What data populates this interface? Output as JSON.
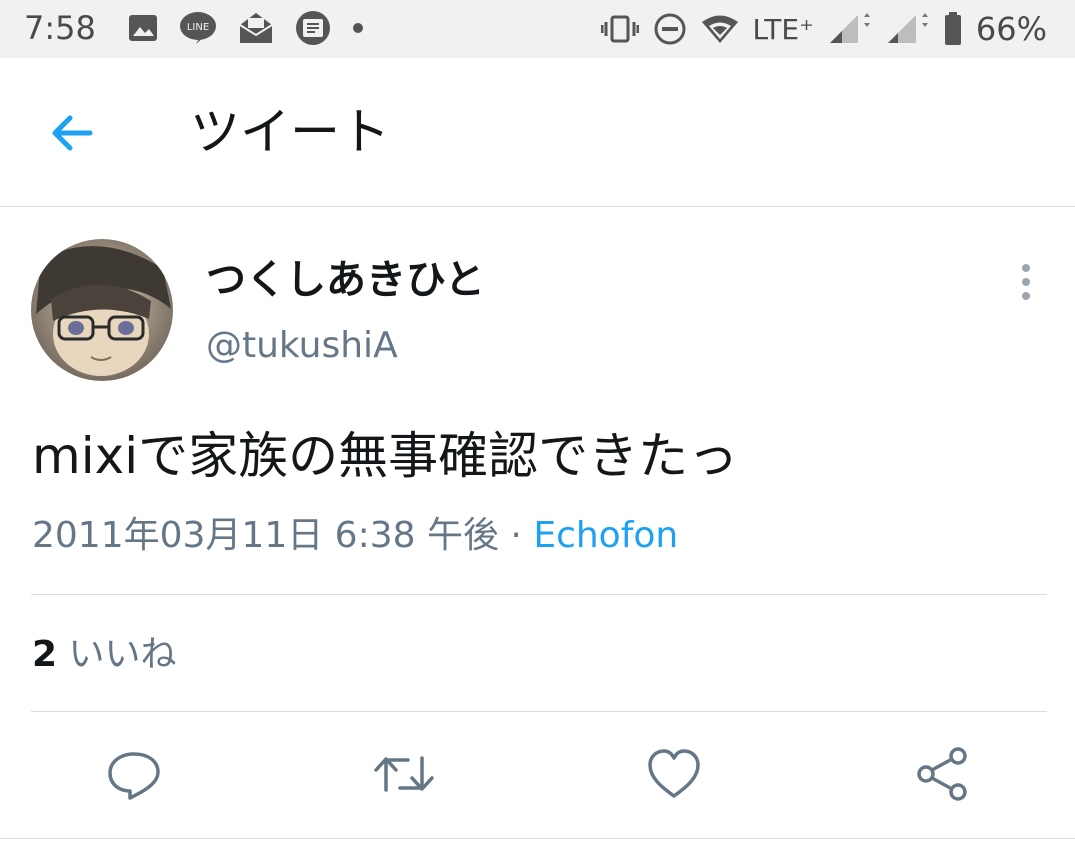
{
  "status_bar": {
    "time": "7:58",
    "left_icons": [
      "image-icon",
      "line-app-icon",
      "yahoo-mail-icon",
      "smartnews-icon",
      "dot-icon"
    ],
    "right_icons": [
      "vibrate-icon",
      "do-not-disturb-icon",
      "wifi-icon",
      "signal-icon",
      "signal-icon",
      "battery-icon"
    ],
    "network": "LTE⁺",
    "battery_percent": "66%"
  },
  "header": {
    "title": "ツイート",
    "back_icon": "arrow-left-icon"
  },
  "tweet": {
    "author_name": "つくしあきひと",
    "author_handle": "@tukushiA",
    "text": "mixiで家族の無事確認できたっ",
    "timestamp": "2011年03月11日 6:38 午後",
    "separator": "·",
    "source": "Echofon",
    "likes_count": "2",
    "likes_label": "いいね"
  },
  "actions": [
    "reply-icon",
    "retweet-icon",
    "like-icon",
    "share-icon"
  ],
  "colors": {
    "accent": "#1da1f2",
    "text_primary": "#14171a",
    "text_secondary": "#657786",
    "icon_gray": "#657786",
    "divider": "#dcdcdc",
    "status_bar_bg": "#f1f1f1"
  }
}
